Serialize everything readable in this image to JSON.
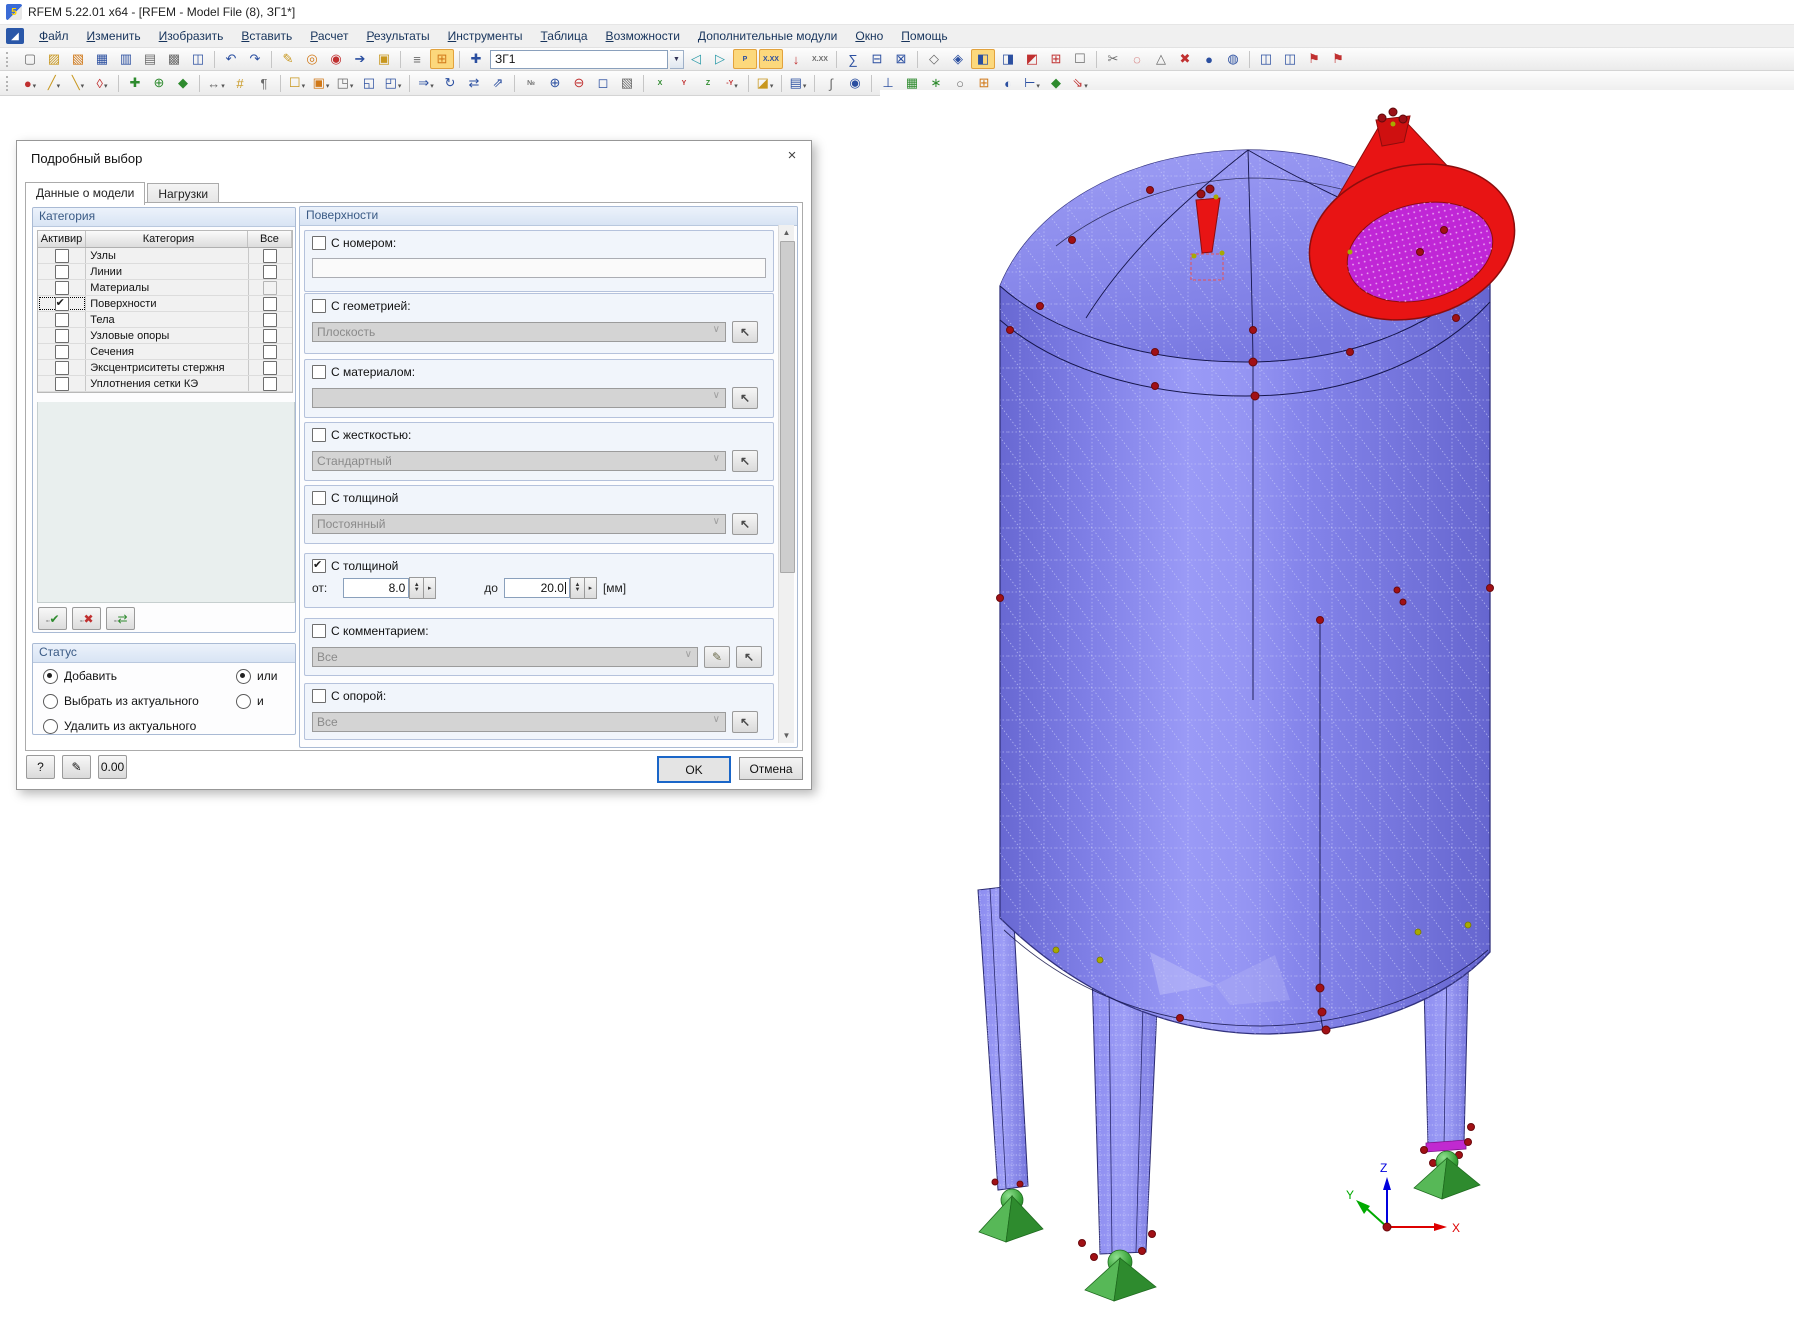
{
  "window": {
    "title": "RFEM 5.22.01 x64 - [RFEM - Model File (8), ЗГ1*]",
    "icon_glyph": "5",
    "menu_icon_glyph": "◢"
  },
  "menu": {
    "items": [
      "Файл",
      "Изменить",
      "Изобразить",
      "Вставить",
      "Расчет",
      "Результаты",
      "Инструменты",
      "Таблица",
      "Возможности",
      "Дополнительные модули",
      "Окно",
      "Помощь"
    ]
  },
  "toolbar_main": {
    "combo_value": "ЗГ1",
    "icons_a": [
      {
        "n": "new-file-button",
        "g": "▢",
        "c": "gy"
      },
      {
        "n": "open-file-button",
        "g": "▨",
        "c": "yl"
      },
      {
        "n": "import-file-button",
        "g": "▧",
        "c": "or"
      },
      {
        "n": "save-as-button",
        "g": "▦",
        "c": "bl"
      },
      {
        "n": "save-button",
        "g": "▥",
        "c": "bl"
      },
      {
        "n": "clipboard-button",
        "g": "▤",
        "c": "gy"
      },
      {
        "n": "print-button",
        "g": "▩",
        "c": "gy"
      },
      {
        "n": "print-preview-button",
        "g": "◫",
        "c": "bl"
      },
      {
        "sep": 1
      },
      {
        "n": "undo-button",
        "g": "↶",
        "c": "bl"
      },
      {
        "n": "redo-button",
        "g": "↷",
        "c": "bl"
      },
      {
        "sep": 1
      },
      {
        "n": "edit-tool-button",
        "g": "✎",
        "c": "yl"
      },
      {
        "n": "snap-settings-button",
        "g": "◎",
        "c": "or"
      },
      {
        "n": "work-plane-button",
        "g": "◉",
        "c": "rd"
      },
      {
        "n": "pointer-tool-button",
        "g": "➔",
        "c": "bl"
      },
      {
        "n": "new-window-button",
        "g": "▣",
        "c": "yl"
      },
      {
        "sep": 1
      },
      {
        "n": "table-list-button",
        "g": "≡",
        "c": "gy"
      },
      {
        "n": "table-grid-button",
        "g": "⊞",
        "c": "or",
        "hl": 1
      },
      {
        "sep": 1
      },
      {
        "n": "new-load-case-button",
        "g": "✚",
        "c": "bl"
      }
    ],
    "icons_b": [
      {
        "n": "prev-load-case-button",
        "g": "◁",
        "c": "tl"
      },
      {
        "n": "next-load-case-button",
        "g": "▷",
        "c": "tl"
      },
      {
        "n": "show-loads-button",
        "g": "P",
        "c": "bl",
        "hl": 1,
        "sm": 1
      },
      {
        "n": "show-load-values-button",
        "g": "X.XX",
        "c": "bl",
        "hl": 1,
        "sm": 1
      },
      {
        "n": "show-results-button",
        "g": "↓",
        "c": "rd"
      },
      {
        "n": "show-result-values-button",
        "g": "X.XX",
        "c": "gy",
        "sm": 1
      },
      {
        "sep": 1
      },
      {
        "n": "calculation-button",
        "g": "∑",
        "c": "bl"
      },
      {
        "n": "calc-table-a-button",
        "g": "⊟",
        "c": "bl"
      },
      {
        "n": "calc-table-b-button",
        "g": "⊠",
        "c": "bl"
      },
      {
        "sep": 1
      },
      {
        "n": "special-selection-button",
        "g": "◇",
        "c": "gy"
      },
      {
        "n": "display-settings-button",
        "g": "◈",
        "c": "bl"
      },
      {
        "n": "show-surfaces-button",
        "g": "◧",
        "c": "bl",
        "hl": 1
      },
      {
        "n": "show-solids-button",
        "g": "◨",
        "c": "bl"
      },
      {
        "n": "show-supports-button",
        "g": "◩",
        "c": "rd"
      },
      {
        "n": "show-fe-mesh-button",
        "g": "⊞",
        "c": "rd"
      },
      {
        "n": "selection-window-button",
        "g": "☐",
        "c": "gy"
      },
      {
        "sep": 1
      },
      {
        "n": "clipping-plane-button",
        "g": "✂",
        "c": "gy"
      },
      {
        "n": "section-circle-button",
        "g": "◌",
        "c": "rd"
      },
      {
        "n": "mirror-tool-button",
        "g": "△",
        "c": "gy"
      },
      {
        "n": "delete-tool-button",
        "g": "✖",
        "c": "rd"
      },
      {
        "n": "object-info-button",
        "g": "●",
        "c": "bl"
      },
      {
        "n": "render-mode-button",
        "g": "◍",
        "c": "bl"
      },
      {
        "sep": 1
      },
      {
        "n": "panel-a-button",
        "g": "◫",
        "c": "bl"
      },
      {
        "n": "panel-b-button",
        "g": "◫",
        "c": "bl"
      },
      {
        "n": "print-flag-a-button",
        "g": "⚑",
        "c": "rd"
      },
      {
        "n": "print-flag-b-button",
        "g": "⚑",
        "c": "rd"
      }
    ]
  },
  "toolbar_second": {
    "icons": [
      {
        "n": "new-node-button",
        "g": "●",
        "c": "rd",
        "dd": 1
      },
      {
        "n": "new-line-button",
        "g": "╱",
        "c": "yl",
        "dd": 1
      },
      {
        "n": "new-member-button",
        "g": "╲",
        "c": "yl",
        "dd": 1
      },
      {
        "n": "new-surface-button",
        "g": "◊",
        "c": "rd",
        "dd": 1
      },
      {
        "sep": 1
      },
      {
        "n": "add-node-button",
        "g": "✚",
        "c": "gn"
      },
      {
        "n": "snap-node-button",
        "g": "⊕",
        "c": "gn"
      },
      {
        "n": "new-solid-button",
        "g": "◆",
        "c": "gn"
      },
      {
        "sep": 1
      },
      {
        "n": "dimensions-button",
        "g": "↔",
        "c": "gy",
        "dd": 1
      },
      {
        "n": "dimension-values-button",
        "g": "#",
        "c": "yl"
      },
      {
        "n": "comment-tool-button",
        "g": "¶",
        "c": "gy"
      },
      {
        "sep": 1
      },
      {
        "n": "select-window-button",
        "g": "☐",
        "c": "yl",
        "dd": 1
      },
      {
        "n": "select-filter-button",
        "g": "▣",
        "c": "or",
        "dd": 1
      },
      {
        "n": "partial-view-button",
        "g": "◳",
        "c": "gy",
        "dd": 1
      },
      {
        "n": "user-view-button",
        "g": "◱",
        "c": "bl"
      },
      {
        "n": "saved-views-button",
        "g": "◰",
        "c": "bl",
        "dd": 1
      },
      {
        "sep": 1
      },
      {
        "n": "move-copy-button",
        "g": "⇒",
        "c": "bl",
        "dd": 1
      },
      {
        "n": "rotate-copy-button",
        "g": "↻",
        "c": "bl"
      },
      {
        "n": "mirror-copy-button",
        "g": "⇄",
        "c": "bl"
      },
      {
        "n": "project-copy-button",
        "g": "⇗",
        "c": "bl"
      },
      {
        "sep": 1
      },
      {
        "n": "renumber-button",
        "g": "№",
        "c": "gy",
        "sm": 1
      },
      {
        "n": "zoom-in-button",
        "g": "⊕",
        "c": "bl"
      },
      {
        "n": "zoom-out-button",
        "g": "⊖",
        "c": "rd"
      },
      {
        "n": "zoom-window-button",
        "g": "◻",
        "c": "bl"
      },
      {
        "n": "isometric-view-button",
        "g": "▧",
        "c": "gy"
      },
      {
        "sep": 1
      },
      {
        "n": "view-x-button",
        "g": "X",
        "c": "gn",
        "sm": 1
      },
      {
        "n": "view-y-button",
        "g": "Y",
        "c": "rd",
        "sm": 1
      },
      {
        "n": "view-z-button",
        "g": "Z",
        "c": "gn",
        "sm": 1
      },
      {
        "n": "view-minus-y-button",
        "g": "-Y",
        "c": "rd",
        "sm": 1,
        "dd": 1
      },
      {
        "sep": 1
      },
      {
        "n": "display-properties-button",
        "g": "◪",
        "c": "yl",
        "dd": 1
      },
      {
        "sep": 1
      },
      {
        "n": "format-painter-button",
        "g": "▤",
        "c": "bl",
        "dd": 1
      },
      {
        "sep": 1
      },
      {
        "n": "line-grid-button",
        "g": "∫",
        "c": "gy"
      },
      {
        "n": "guide-lines-button",
        "g": "◉",
        "c": "bl"
      },
      {
        "sep": 1
      },
      {
        "n": "nodal-support-button",
        "g": "⊥",
        "c": "bl"
      },
      {
        "n": "mesh-refinement-button",
        "g": "▦",
        "c": "gn"
      },
      {
        "n": "generate-mesh-button",
        "g": "∗",
        "c": "gn"
      },
      {
        "n": "ellipse-tool-button",
        "g": "○",
        "c": "gy"
      },
      {
        "n": "block-tool-button",
        "g": "⊞",
        "c": "or"
      },
      {
        "n": "half-view-button",
        "g": "◐",
        "c": "bl"
      },
      {
        "n": "axes-toggle-button",
        "g": "⊢",
        "c": "bl",
        "dd": 1
      },
      {
        "n": "solid-gen-button",
        "g": "◆",
        "c": "gn"
      },
      {
        "n": "load-generation-button",
        "g": "⇘",
        "c": "rd",
        "dd": 1
      }
    ]
  },
  "dialog": {
    "title": "Подробный выбор",
    "tabs": [
      {
        "label": "Данные о модели",
        "active": true
      },
      {
        "label": "Нагрузки",
        "active": false
      }
    ],
    "category_group": {
      "title": "Категория",
      "columns": [
        "Активир",
        "Категория",
        "Все"
      ],
      "rows": [
        {
          "label": "Узлы",
          "active": false,
          "all": false
        },
        {
          "label": "Линии",
          "active": false,
          "all": false
        },
        {
          "label": "Материалы",
          "active": false,
          "all": false,
          "all_disabled": true
        },
        {
          "label": "Поверхности",
          "active": true,
          "all": false,
          "focused": true
        },
        {
          "label": "Тела",
          "active": false,
          "all": false
        },
        {
          "label": "Узловые опоры",
          "active": false,
          "all": false
        },
        {
          "label": "Сечения",
          "active": false,
          "all": false
        },
        {
          "label": "Эксцентриситеты стержня",
          "active": false,
          "all": false
        },
        {
          "label": "Уплотнения сетки КЭ",
          "active": false,
          "all": false
        }
      ],
      "tools": [
        {
          "n": "select-all-categories-button",
          "g": "✔",
          "c": "gn"
        },
        {
          "n": "deselect-all-categories-button",
          "g": "✖",
          "c": "rd"
        },
        {
          "n": "invert-category-selection-button",
          "g": "⇄",
          "c": "gn"
        }
      ]
    },
    "status_group": {
      "title": "Статус",
      "options": [
        {
          "n": "status-add-radio",
          "label": "Добавить",
          "sel": true
        },
        {
          "n": "status-select-from-current-radio",
          "label": "Выбрать из актуального",
          "sel": false
        },
        {
          "n": "status-remove-from-current-radio",
          "label": "Удалить из актуального",
          "sel": false
        }
      ],
      "logic": [
        {
          "n": "logic-or-radio",
          "label": "или",
          "sel": true
        },
        {
          "n": "logic-and-radio",
          "label": "и",
          "sel": false
        }
      ]
    },
    "surfaces_group": {
      "title": "Поверхности",
      "sections": [
        {
          "label": "С номером:",
          "checked": false,
          "value": ""
        },
        {
          "label": "С геометрией:",
          "checked": false,
          "value": "Плоскость",
          "disabled": true
        },
        {
          "label": "С материалом:",
          "checked": false,
          "value": "",
          "disabled": true
        },
        {
          "label": "С жесткостью:",
          "checked": false,
          "value": "Стандартный",
          "disabled": true
        },
        {
          "label": "С толщиной",
          "checked": false,
          "value": "Постоянный",
          "disabled": true
        },
        {
          "label": "С толщиной",
          "checked": true,
          "from_label": "от:",
          "from_value": "8.0",
          "to_label": "до",
          "to_value": "20.0",
          "unit": "[мм]"
        },
        {
          "label": "С комментарием:",
          "checked": false,
          "value": "Все",
          "disabled": true
        },
        {
          "label": "С опорой:",
          "checked": false,
          "value": "Все",
          "disabled": true
        }
      ]
    },
    "footer_tools": [
      {
        "n": "help-button",
        "g": "?",
        "c": "hp"
      },
      {
        "n": "comment-note-button",
        "g": "✎",
        "c": "cm"
      },
      {
        "n": "units-settings-button",
        "g": "0.00",
        "c": "un"
      }
    ],
    "ok_label": "OK",
    "cancel_label": "Отмена"
  },
  "viewport": {
    "axis": {
      "x": "X",
      "y": "Y",
      "z": "Z"
    },
    "colors": {
      "tank": "#8080e8",
      "nozzle_red": "#e81414",
      "manhole_magenta": "#c026d6",
      "support_green": "#2e8b2e",
      "node_red": "#a11015"
    }
  }
}
